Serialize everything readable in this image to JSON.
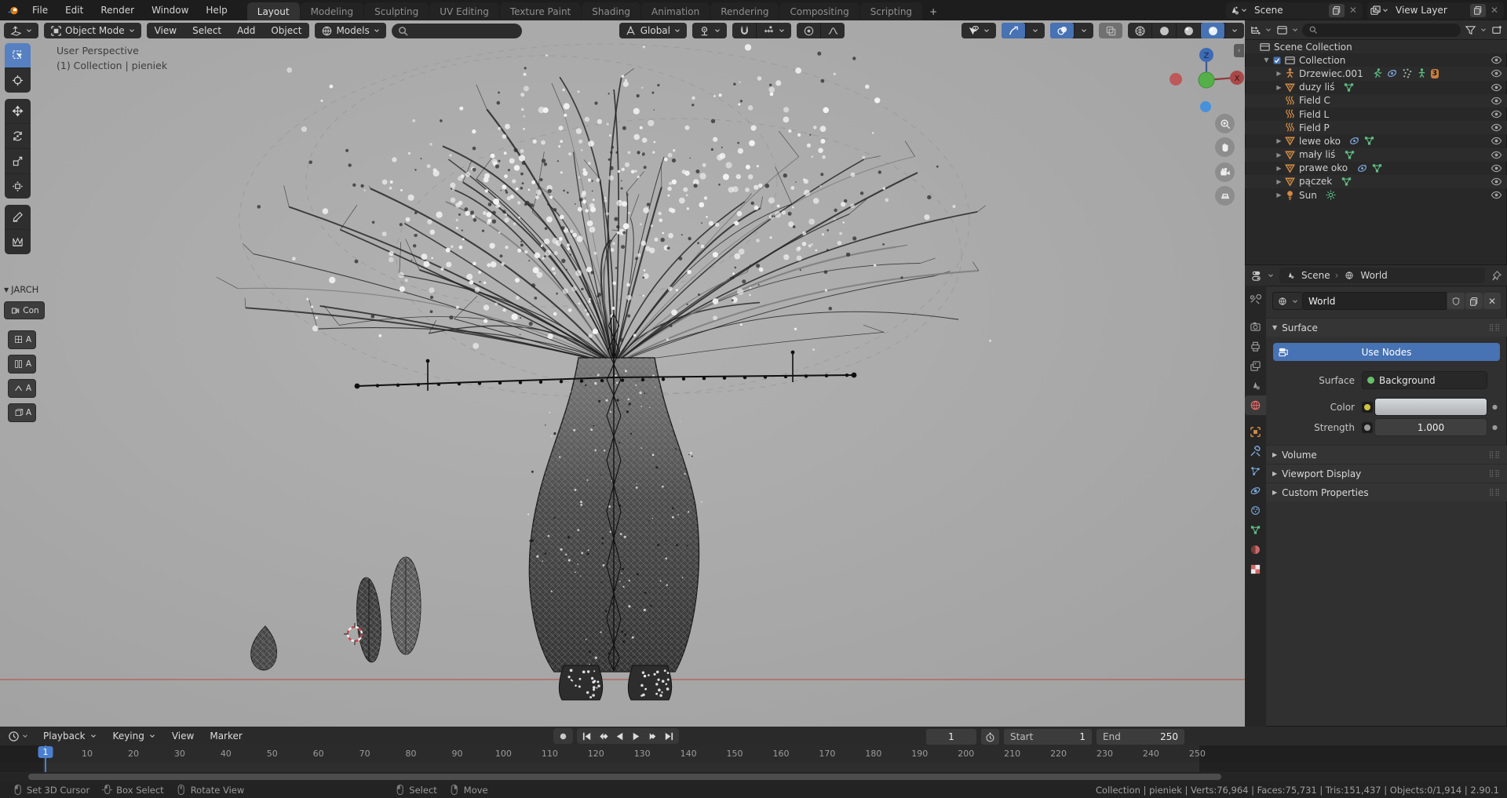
{
  "topbar": {
    "menus": [
      "File",
      "Edit",
      "Render",
      "Window",
      "Help"
    ],
    "tabs": [
      "Layout",
      "Modeling",
      "Sculpting",
      "UV Editing",
      "Texture Paint",
      "Shading",
      "Animation",
      "Rendering",
      "Compositing",
      "Scripting"
    ],
    "active_tab": "Layout",
    "add_tab_label": "+",
    "scene_name": "Scene",
    "view_layer_name": "View Layer"
  },
  "viewport_header": {
    "mode": "Object Mode",
    "menus": [
      "View",
      "Select",
      "Add",
      "Object"
    ],
    "models_label": "Models",
    "orientation": "Global",
    "search_value": ""
  },
  "viewport": {
    "perspective_label": "User Perspective",
    "context_label": "(1) Collection | pieniek",
    "axis_z": "Z",
    "axis_x": "X"
  },
  "tools": [
    "select-box",
    "cursor",
    "move",
    "rotate",
    "scale",
    "transform",
    "annotate",
    "measure"
  ],
  "jarch": {
    "title": "JARCH",
    "con_label": "Con",
    "grid_buttons": [
      "A",
      "A",
      "A",
      "A"
    ]
  },
  "outliner": {
    "rows": [
      {
        "label": "Scene Collection",
        "icon": "collection",
        "level": 0,
        "disclosure": "",
        "checkbox": false,
        "badges": [],
        "eye": false
      },
      {
        "label": "Collection",
        "icon": "collection",
        "level": 1,
        "disclosure": "down",
        "checkbox": true,
        "badges": [],
        "eye": true
      },
      {
        "label": "Drzewiec.001",
        "icon": "armature",
        "level": 2,
        "disclosure": "right",
        "checkbox": false,
        "badges": [
          "pose",
          "physics",
          "particles",
          "posemode",
          "mesh3"
        ],
        "eye": true
      },
      {
        "label": "duzy liś",
        "icon": "mesh",
        "level": 2,
        "disclosure": "right",
        "checkbox": false,
        "badges": [
          "meshdata"
        ],
        "eye": true
      },
      {
        "label": "Field C",
        "icon": "force",
        "level": 2,
        "disclosure": "",
        "checkbox": false,
        "badges": [],
        "eye": true
      },
      {
        "label": "Field L",
        "icon": "force",
        "level": 2,
        "disclosure": "",
        "checkbox": false,
        "badges": [],
        "eye": true
      },
      {
        "label": "Field P",
        "icon": "force",
        "level": 2,
        "disclosure": "",
        "checkbox": false,
        "badges": [],
        "eye": true
      },
      {
        "label": "lewe oko",
        "icon": "mesh",
        "level": 2,
        "disclosure": "right",
        "checkbox": false,
        "badges": [
          "physics",
          "meshdata"
        ],
        "eye": true
      },
      {
        "label": "mały liś",
        "icon": "mesh",
        "level": 2,
        "disclosure": "right",
        "checkbox": false,
        "badges": [
          "meshdata"
        ],
        "eye": true
      },
      {
        "label": "prawe oko",
        "icon": "mesh",
        "level": 2,
        "disclosure": "right",
        "checkbox": false,
        "badges": [
          "physics",
          "meshdata"
        ],
        "eye": true
      },
      {
        "label": "pączek",
        "icon": "mesh",
        "level": 2,
        "disclosure": "right",
        "checkbox": false,
        "badges": [
          "meshdata"
        ],
        "eye": true
      },
      {
        "label": "Sun",
        "icon": "light",
        "level": 2,
        "disclosure": "right",
        "checkbox": false,
        "badges": [
          "sundata"
        ],
        "eye": true
      }
    ],
    "mesh_badge_count": "3"
  },
  "properties": {
    "breadcrumb_scene": "Scene",
    "breadcrumb_world": "World",
    "world_name": "World",
    "tabs": [
      "tool",
      "render",
      "output",
      "view-layer",
      "scene",
      "world",
      "object",
      "modifiers",
      "constraints",
      "physics",
      "particles",
      "data",
      "material",
      "texture"
    ],
    "active_tab": "world",
    "surface_panel": {
      "title": "Surface",
      "use_nodes_label": "Use Nodes",
      "surface_label": "Surface",
      "surface_value": "Background",
      "color_label": "Color",
      "strength_label": "Strength",
      "strength_value": "1.000"
    },
    "collapsed_panels": [
      "Volume",
      "Viewport Display",
      "Custom Properties"
    ]
  },
  "timeline": {
    "dropdown_menus": [
      "Playback",
      "Keying"
    ],
    "plain_menus": [
      "View",
      "Marker"
    ],
    "playback_buttons": [
      "record",
      "jump-first",
      "prev-keyframe",
      "play-reverse",
      "play",
      "next-keyframe",
      "jump-last"
    ],
    "current_frame": "1",
    "start_label": "Start",
    "start_value": "1",
    "end_label": "End",
    "end_value": "250",
    "marker_label": "1",
    "ticks": [
      10,
      20,
      30,
      40,
      50,
      60,
      70,
      80,
      90,
      100,
      110,
      120,
      130,
      140,
      150,
      160,
      170,
      180,
      190,
      200,
      210,
      220,
      230,
      240,
      250
    ]
  },
  "statusbar": {
    "hints": [
      {
        "icon": "mouse-left",
        "label": "Set 3D Cursor"
      },
      {
        "icon": "mouse-left-drag",
        "label": "Box Select"
      },
      {
        "icon": "mouse-middle",
        "label": "Rotate View"
      },
      {
        "icon": "mouse-left",
        "label": "Select"
      },
      {
        "icon": "mouse-right",
        "label": "Move"
      }
    ],
    "stats": "Collection | pieniek | Verts:76,964 | Faces:75,731 | Tris:151,437 | Objects:0/1,914 | 2.90.1"
  },
  "colors": {
    "accent_blue": "#4772b3",
    "tool_active_blue": "#5680c2",
    "icon_orange": "#cf8a45",
    "icon_green": "#5fbd84",
    "icon_blue": "#7ba6d9",
    "world_red": "#e36a6a",
    "axis_red": "#b34b4b",
    "playhead_blue": "#4a7fd0"
  }
}
